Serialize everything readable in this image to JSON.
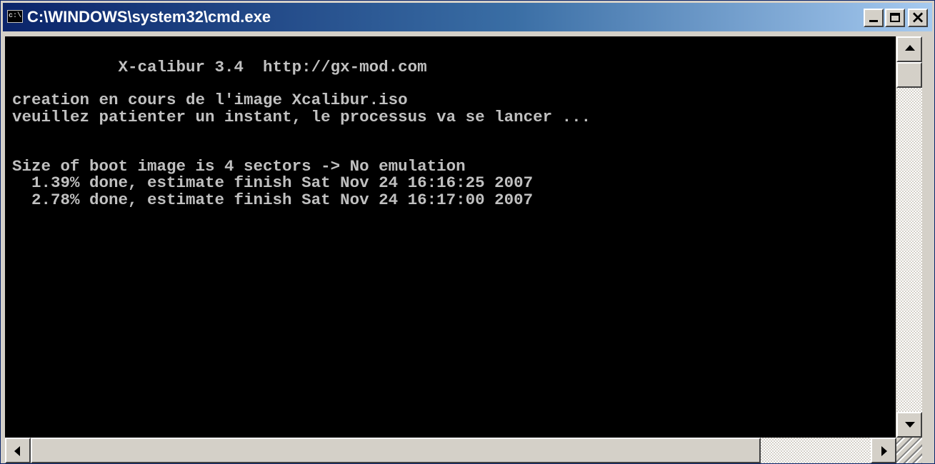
{
  "window": {
    "title": "C:\\WINDOWS\\system32\\cmd.exe",
    "icon_label": "c:\\",
    "buttons": [
      "minimize",
      "maximize",
      "close"
    ],
    "close_glyph": "×"
  },
  "console": {
    "text": "           X-calibur 3.4  http://gx-mod.com\n\ncreation en cours de l'image Xcalibur.iso\nveuillez patienter un instant, le processus va se lancer ...\n\n\nSize of boot image is 4 sectors -> No emulation\n  1.39% done, estimate finish Sat Nov 24 16:16:25 2007\n  2.78% done, estimate finish Sat Nov 24 16:17:00 2007",
    "foreground": "#c0c0c0",
    "background": "#000000"
  },
  "colors": {
    "titlebar_start": "#0a246a",
    "titlebar_end": "#a6caf0",
    "chrome": "#d4d0c8"
  }
}
